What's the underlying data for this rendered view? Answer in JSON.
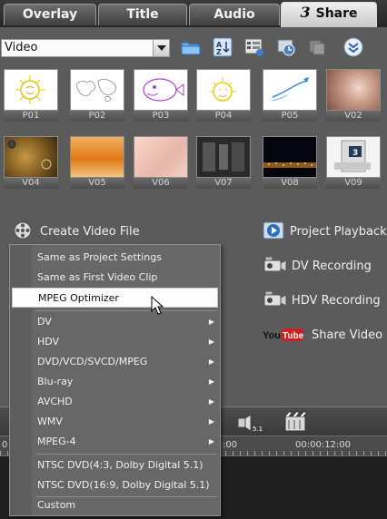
{
  "tabs": [
    {
      "label": "Overlay"
    },
    {
      "label": "Title"
    },
    {
      "label": "Audio"
    },
    {
      "num": "3",
      "label": "Share"
    }
  ],
  "toolbar": {
    "dropdown_value": "Video"
  },
  "thumbnails": [
    {
      "caption": "P01"
    },
    {
      "caption": "P02"
    },
    {
      "caption": "P03"
    },
    {
      "caption": "P04"
    },
    {
      "caption": "P05"
    },
    {
      "caption": "V02"
    },
    {
      "caption": "V04"
    },
    {
      "caption": "V05"
    },
    {
      "caption": "V06"
    },
    {
      "caption": "V07"
    },
    {
      "caption": "V08"
    },
    {
      "caption": "V09"
    }
  ],
  "share": {
    "create_video_file": "Create Video File",
    "project_playback": "Project Playback",
    "dv_recording": "DV Recording",
    "hdv_recording": "HDV Recording",
    "youtube_logo_text": "YouTube",
    "share_video_online": "Share Video O"
  },
  "timeline": {
    "ruler_left": "0",
    "ruler_mid": ":00",
    "ruler_time": "00:00:12:00"
  },
  "menu": {
    "items": [
      {
        "label": "Same as Project Settings"
      },
      {
        "label": "Same as First Video Clip"
      },
      {
        "label": "MPEG Optimizer"
      },
      {
        "label": "DV"
      },
      {
        "label": "HDV"
      },
      {
        "label": "DVD/VCD/SVCD/MPEG"
      },
      {
        "label": "Blu-ray"
      },
      {
        "label": "AVCHD"
      },
      {
        "label": "WMV"
      },
      {
        "label": "MPEG-4"
      },
      {
        "label": "NTSC  DVD(4:3, Dolby Digital 5.1)"
      },
      {
        "label": "NTSC  DVD(16:9, Dolby Digital 5.1)"
      },
      {
        "label": "Custom"
      }
    ],
    "submenu_arrow": "▶"
  }
}
